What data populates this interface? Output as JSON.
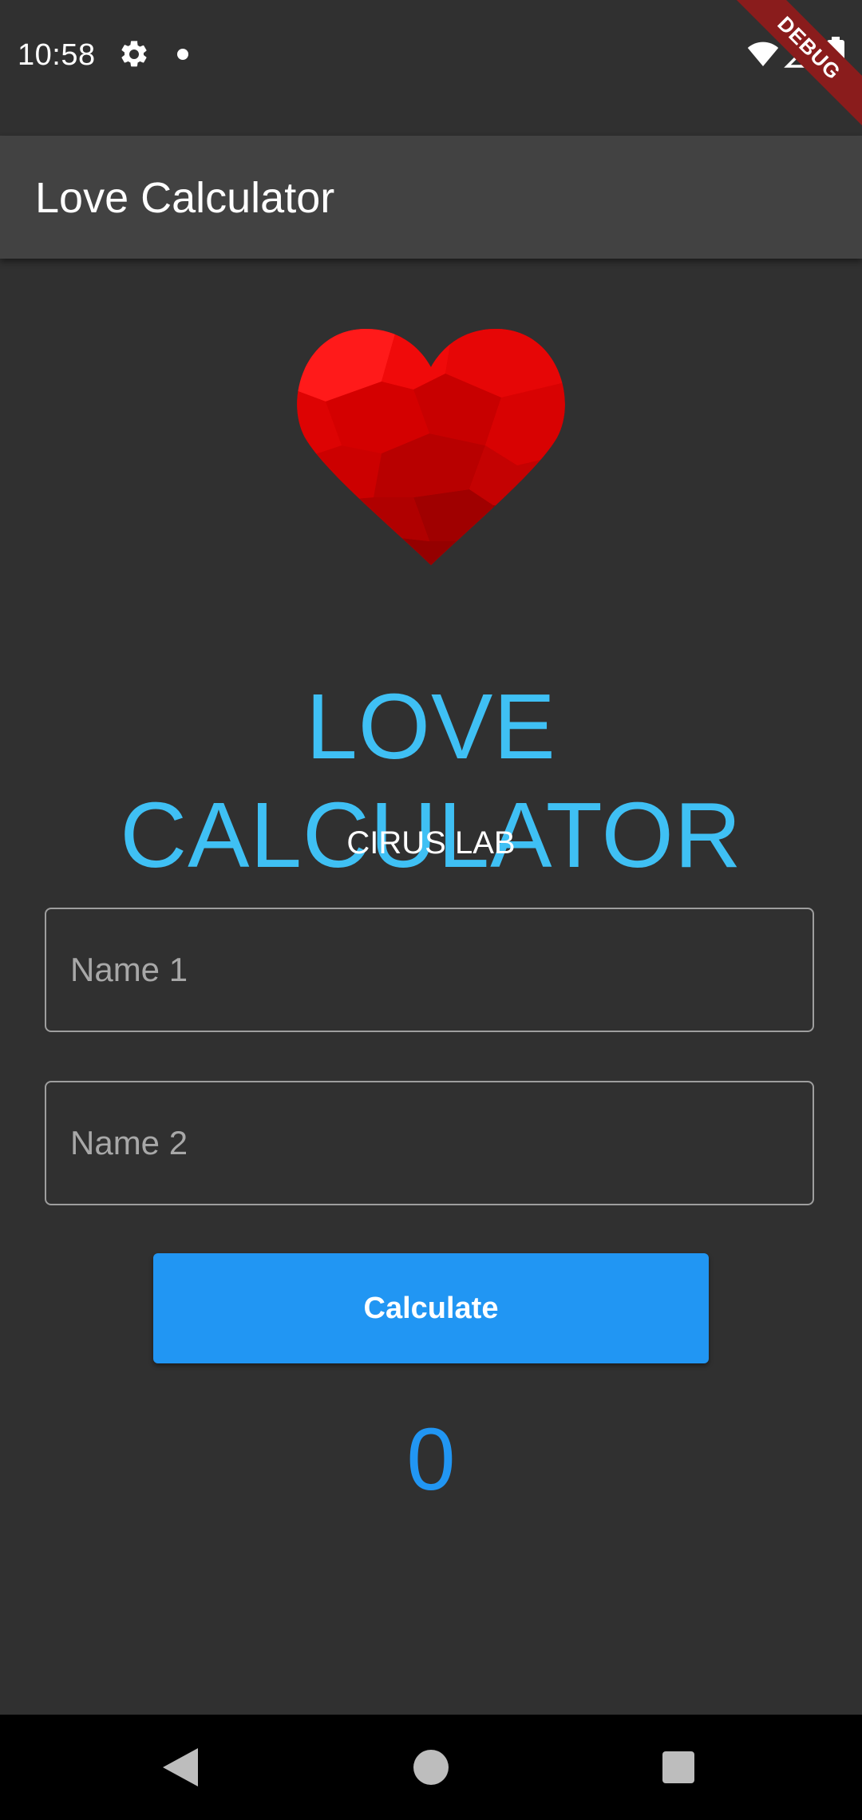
{
  "status_bar": {
    "time": "10:58",
    "icons": [
      "gear-icon",
      "notification-dot-icon",
      "wifi-icon",
      "signal-icon",
      "battery-icon"
    ]
  },
  "debug_banner": {
    "label": "DEBUG"
  },
  "app_bar": {
    "title": "Love Calculator"
  },
  "main": {
    "image": "heart-icon",
    "heading": "LOVE CALCULATOR",
    "subheading": "CIRUS LAB",
    "name1": {
      "placeholder": "Name 1",
      "value": ""
    },
    "name2": {
      "placeholder": "Name 2",
      "value": ""
    },
    "button_label": "Calculate",
    "result": "0"
  },
  "nav_bar": {
    "icons": [
      "back-icon",
      "home-icon",
      "recents-icon"
    ]
  },
  "colors": {
    "background": "#303030",
    "app_bar": "#424242",
    "heading": "#3fc0f4",
    "primary": "#2196f3",
    "heart": "#e00000",
    "debug_ribbon": "#8a1c1c"
  }
}
